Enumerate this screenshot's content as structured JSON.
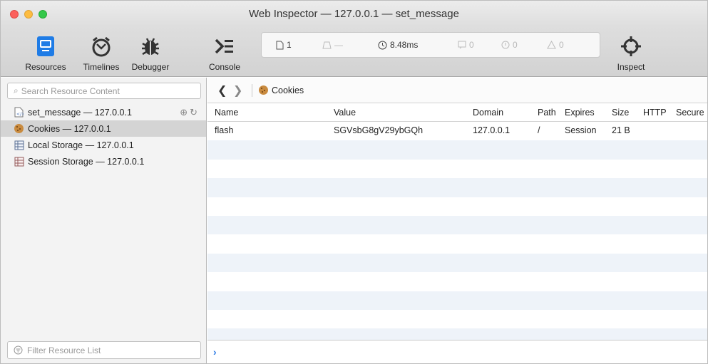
{
  "window": {
    "title": "Web Inspector — 127.0.0.1 — set_message"
  },
  "toolbar": {
    "resources_label": "Resources",
    "timelines_label": "Timelines",
    "debugger_label": "Debugger",
    "console_label": "Console",
    "inspect_label": "Inspect",
    "accent_color": "#1f7ce6"
  },
  "dashboard": {
    "resources_count": "1",
    "load_dash": "—",
    "load_time": "8.48ms",
    "logs": "0",
    "errors": "0",
    "warnings": "0"
  },
  "sidebar": {
    "search_placeholder": "Search Resource Content",
    "filter_placeholder": "Filter Resource List",
    "items": [
      {
        "label": "set_message — 127.0.0.1",
        "icon": "document-icon"
      },
      {
        "label": "Cookies — 127.0.0.1",
        "icon": "cookie-icon"
      },
      {
        "label": "Local Storage — 127.0.0.1",
        "icon": "table-icon"
      },
      {
        "label": "Session Storage — 127.0.0.1",
        "icon": "table-icon"
      }
    ]
  },
  "content": {
    "breadcrumb": "Cookies",
    "columns": [
      "Name",
      "Value",
      "Domain",
      "Path",
      "Expires",
      "Size",
      "HTTP",
      "Secure"
    ],
    "rows": [
      {
        "name": "flash",
        "value": "SGVsbG8gV29ybGQh",
        "domain": "127.0.0.1",
        "path": "/",
        "expires": "Session",
        "size": "21 B",
        "http": "",
        "secure": ""
      }
    ],
    "console_prompt": "›"
  }
}
